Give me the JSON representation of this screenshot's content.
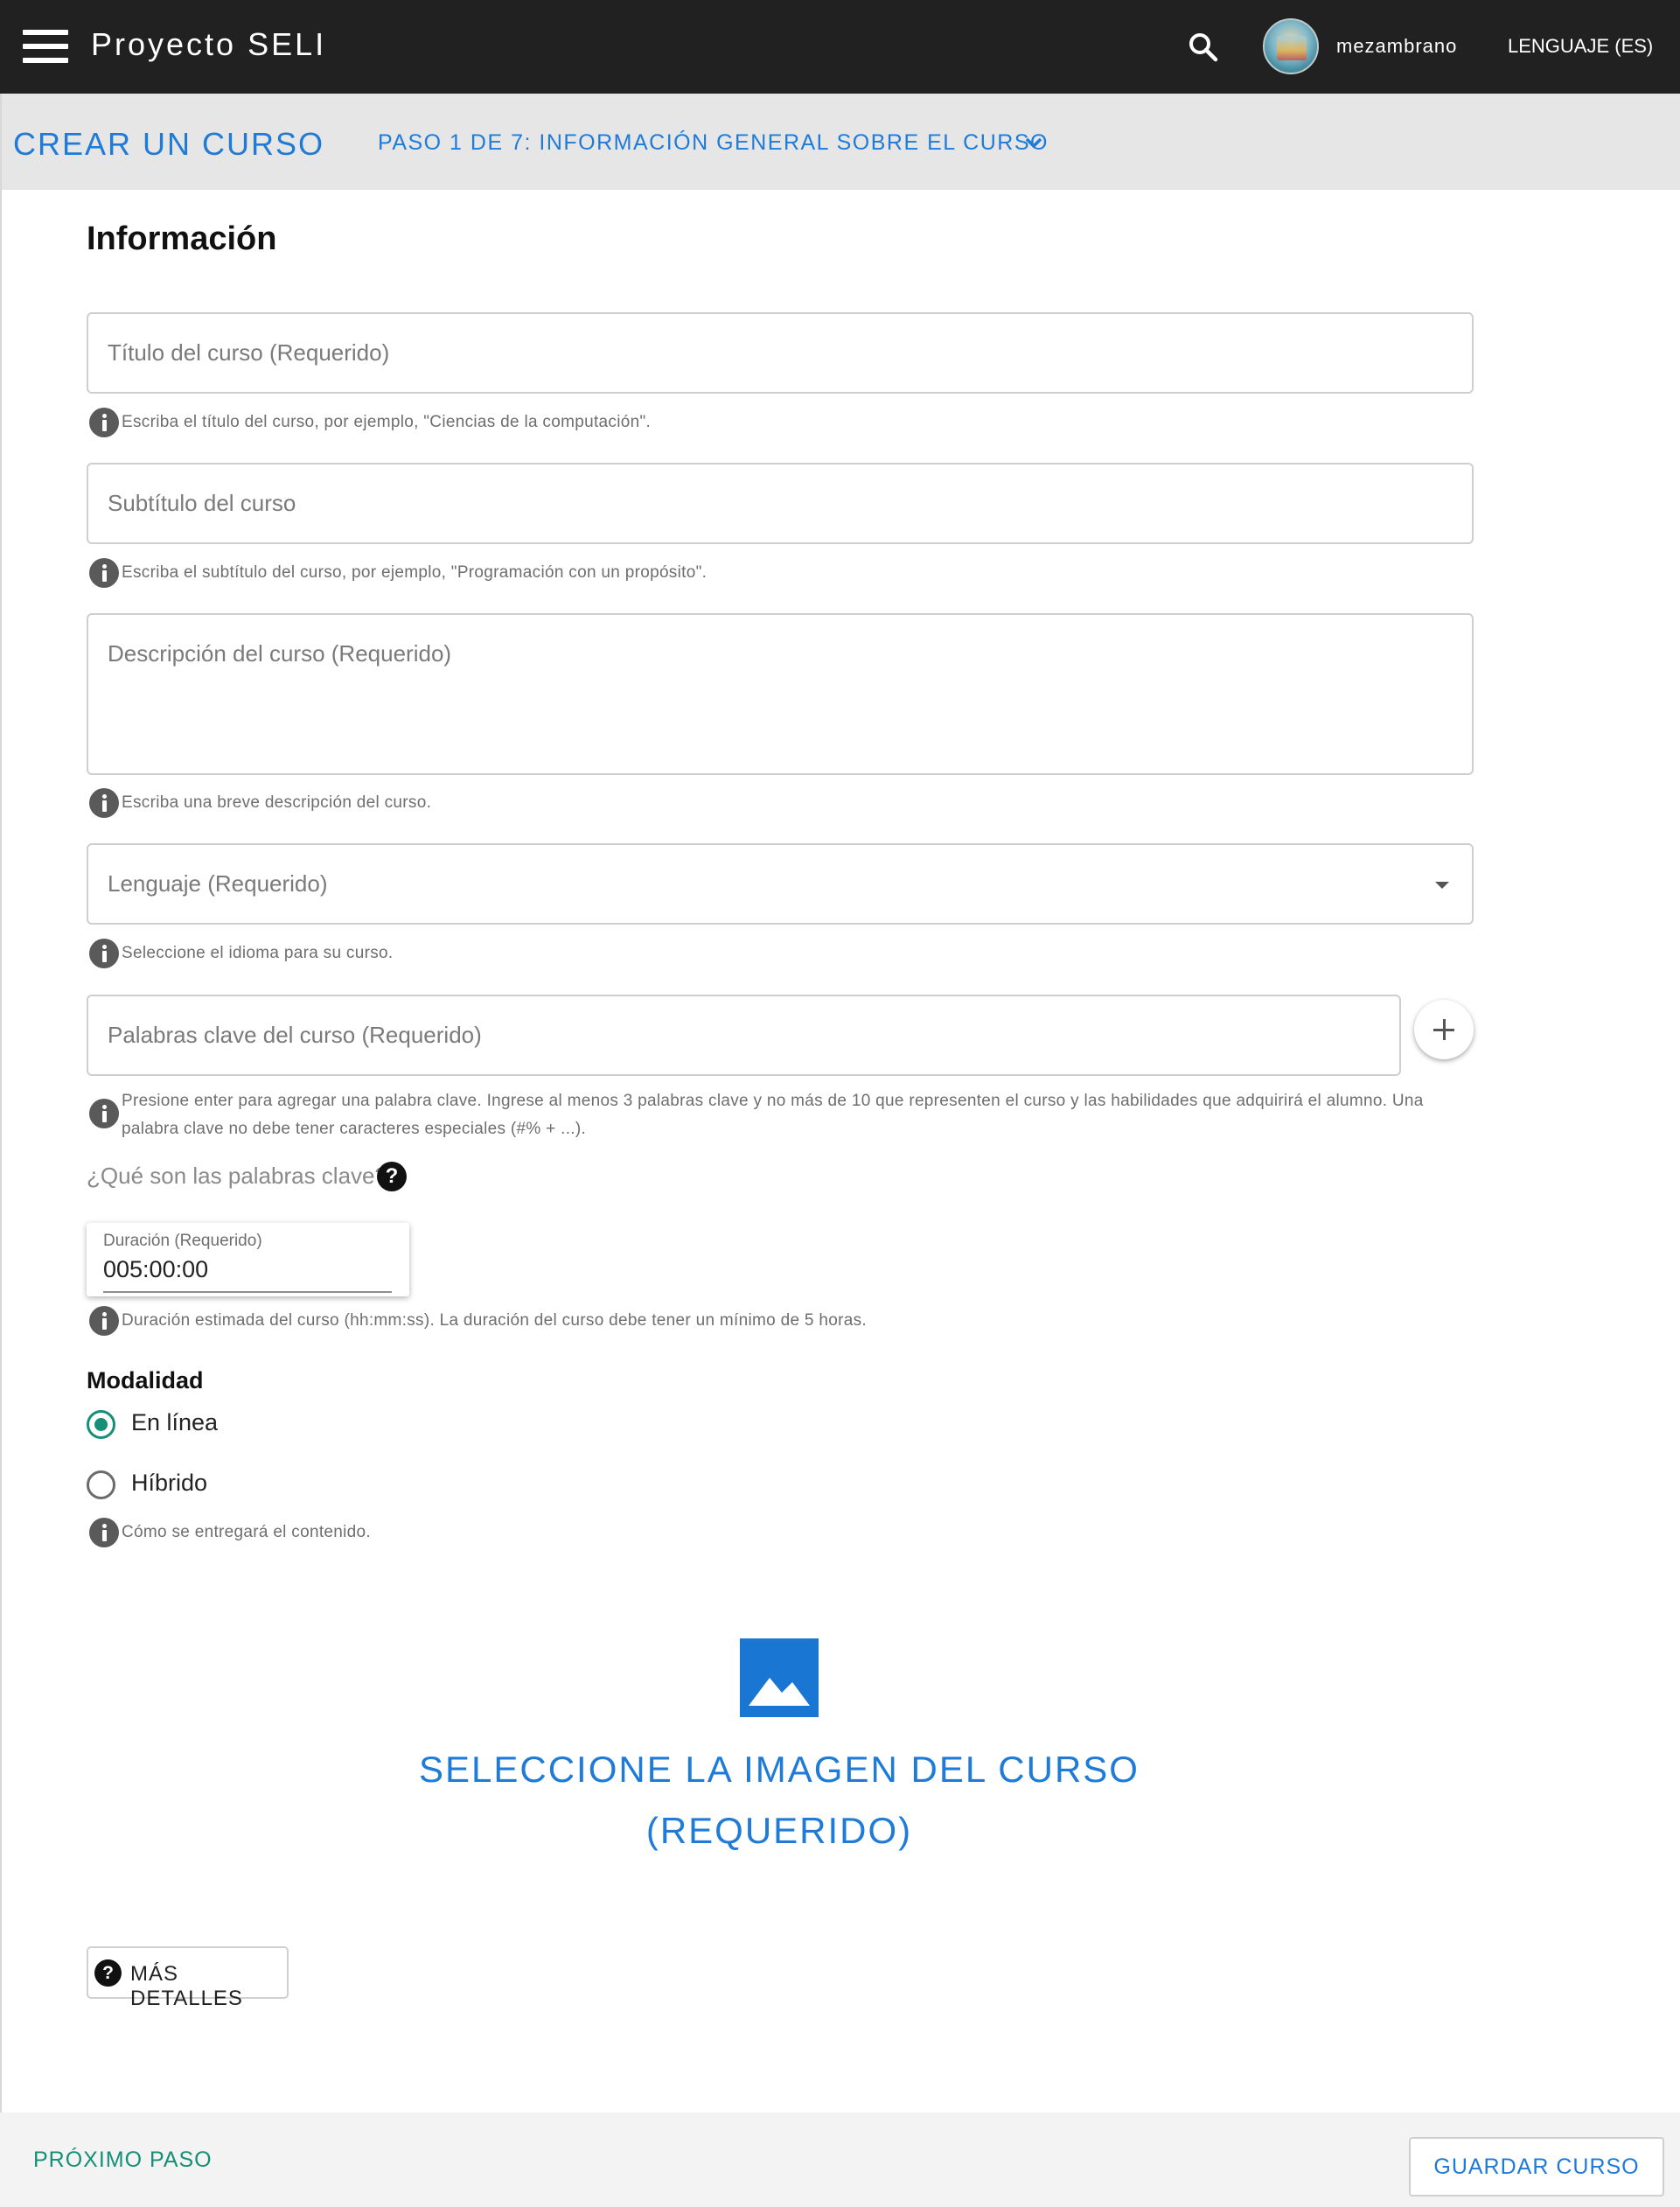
{
  "app": {
    "title": "Proyecto SELI",
    "username": "mezambrano",
    "language_button": "LENGUAJE (ES)"
  },
  "subheader": {
    "title": "CREAR UN CURSO",
    "step_label": "PASO 1 DE 7: INFORMACIÓN GENERAL SOBRE EL CURSO"
  },
  "form": {
    "section_title": "Información",
    "title_field": {
      "placeholder": "Título del curso (Requerido)",
      "value": "",
      "helper": "Escriba el título del curso, por ejemplo, \"Ciencias de la computación\"."
    },
    "subtitle_field": {
      "placeholder": "Subtítulo del curso",
      "value": "",
      "helper": "Escriba el subtítulo del curso, por ejemplo, \"Programación con un propósito\"."
    },
    "description_field": {
      "placeholder": "Descripción del curso (Requerido)",
      "value": "",
      "helper": "Escriba una breve descripción del curso."
    },
    "language_field": {
      "placeholder": "Lenguaje (Requerido)",
      "selected": "",
      "helper": "Seleccione el idioma para su curso."
    },
    "keywords_field": {
      "placeholder": "Palabras clave del curso (Requerido)",
      "value": "",
      "helper_line1": "Presione enter para agregar una palabra clave. Ingrese al menos 3 palabras clave y no más de 10 que representen el curso y las habilidades que adquirirá el alumno. Una",
      "helper_line2": "palabra clave no debe tener caracteres especiales (#% + ...)."
    },
    "keywords_help_link": "¿Qué son las palabras clave?",
    "duration_field": {
      "label": "Duración (Requerido)",
      "value": "005:00:00",
      "helper": "Duración estimada del curso (hh:mm:ss). La duración del curso debe tener un mínimo de 5 horas."
    },
    "modality": {
      "title": "Modalidad",
      "options": [
        "En línea",
        "Híbrido"
      ],
      "selected": "En línea",
      "helper": "Cómo se entregará el contenido."
    },
    "image_select": {
      "line1": "SELECCIONE LA IMAGEN DEL CURSO",
      "line2": "(REQUERIDO)"
    },
    "more_details_button": "MÁS DETALLES"
  },
  "footer": {
    "next_step": "PRÓXIMO PASO",
    "save_course": "GUARDAR CURSO"
  },
  "colors": {
    "appbar": "#212121",
    "accent_blue": "#1f7bd8",
    "accent_green": "#158f76",
    "subheader_bg": "#e6e6e6"
  },
  "icons": [
    "menu-icon",
    "search-icon",
    "chevron-down-icon",
    "info-icon",
    "dropdown-caret-icon",
    "add-icon",
    "help-icon",
    "image-icon"
  ]
}
